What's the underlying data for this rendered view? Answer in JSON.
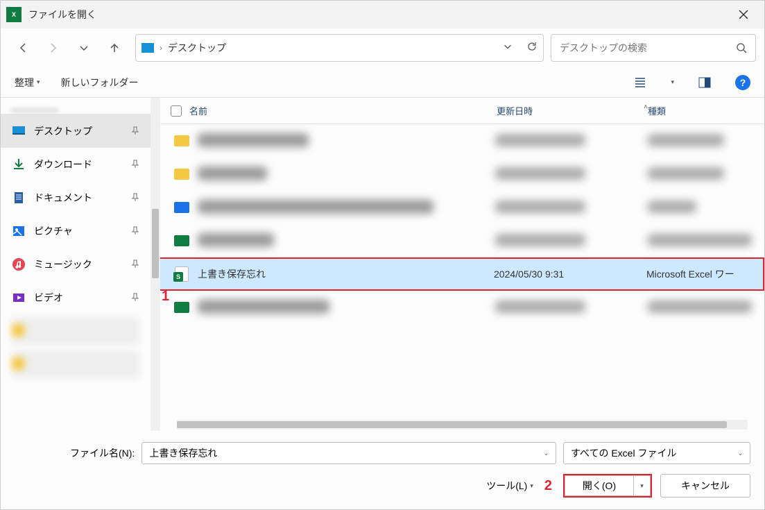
{
  "titlebar": {
    "app_icon_letter": "X",
    "title": "ファイルを開く"
  },
  "breadcrumb": {
    "location": "デスクトップ"
  },
  "search": {
    "placeholder": "デスクトップの検索"
  },
  "toolbar": {
    "organize": "整理",
    "new_folder": "新しいフォルダー",
    "help_glyph": "?"
  },
  "sidebar": {
    "items": [
      {
        "label": "デスクトップ",
        "icon": "desktop",
        "selected": true
      },
      {
        "label": "ダウンロード",
        "icon": "download",
        "selected": false
      },
      {
        "label": "ドキュメント",
        "icon": "document",
        "selected": false
      },
      {
        "label": "ピクチャ",
        "icon": "pictures",
        "selected": false
      },
      {
        "label": "ミュージック",
        "icon": "music",
        "selected": false
      },
      {
        "label": "ビデオ",
        "icon": "video",
        "selected": false
      }
    ]
  },
  "columns": {
    "name": "名前",
    "date": "更新日時",
    "type": "種類"
  },
  "rows": [
    {
      "blurred": true,
      "icon": "folder-yellow"
    },
    {
      "blurred": true,
      "icon": "folder-yellow"
    },
    {
      "blurred": true,
      "icon": "folder-blue"
    },
    {
      "blurred": true,
      "icon": "file-green"
    },
    {
      "blurred": false,
      "selected": true,
      "icon": "file-excel",
      "name": "上書き保存忘れ",
      "date": "2024/05/30 9:31",
      "type": "Microsoft Excel ワー"
    },
    {
      "blurred": true,
      "icon": "file-green"
    }
  ],
  "annotations": {
    "one": "1",
    "two": "2"
  },
  "footer": {
    "filename_label": "ファイル名(N):",
    "filename_value": "上書き保存忘れ",
    "filetype_value": "すべての Excel ファイル",
    "tools_label": "ツール(L)",
    "open_label": "開く(O)",
    "cancel_label": "キャンセル"
  }
}
